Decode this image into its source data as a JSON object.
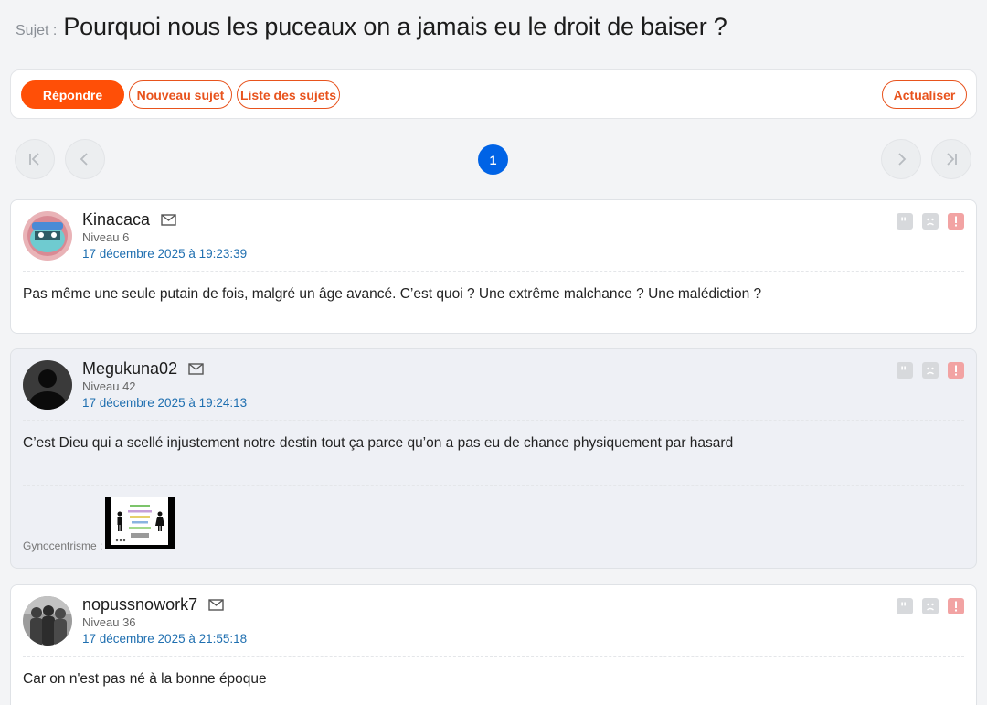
{
  "topic": {
    "prefix": "Sujet :",
    "title": "Pourquoi nous les puceaux on a jamais eu le droit de baiser ?"
  },
  "toolbar": {
    "reply": "Répondre",
    "new_topic": "Nouveau sujet",
    "topic_list": "Liste des sujets",
    "refresh": "Actualiser"
  },
  "pagination": {
    "current_page": "1"
  },
  "colors": {
    "accent": "#ff4f07",
    "link": "#1f6fb0",
    "page_active": "#0063e6"
  },
  "posts": [
    {
      "author": "Kinacaca",
      "level": "Niveau 6",
      "date": "17 décembre 2025 à 19:23:39",
      "message": "Pas même une seule putain de fois, malgré un âge avancé. C’est quoi ? Une extrême malchance ? Une malédiction ?"
    },
    {
      "author": "Megukuna02",
      "level": "Niveau 42",
      "date": "17 décembre 2025 à 19:24:13",
      "message": "C’est Dieu qui a scellé injustement notre destin tout ça parce qu’on a pas eu de chance physiquement par hasard",
      "signature": "Gynocentrisme :"
    },
    {
      "author": "nopussnowork7",
      "level": "Niveau 36",
      "date": "17 décembre 2025 à 21:55:18",
      "message": "Car on n'est pas né à la bonne époque"
    }
  ]
}
